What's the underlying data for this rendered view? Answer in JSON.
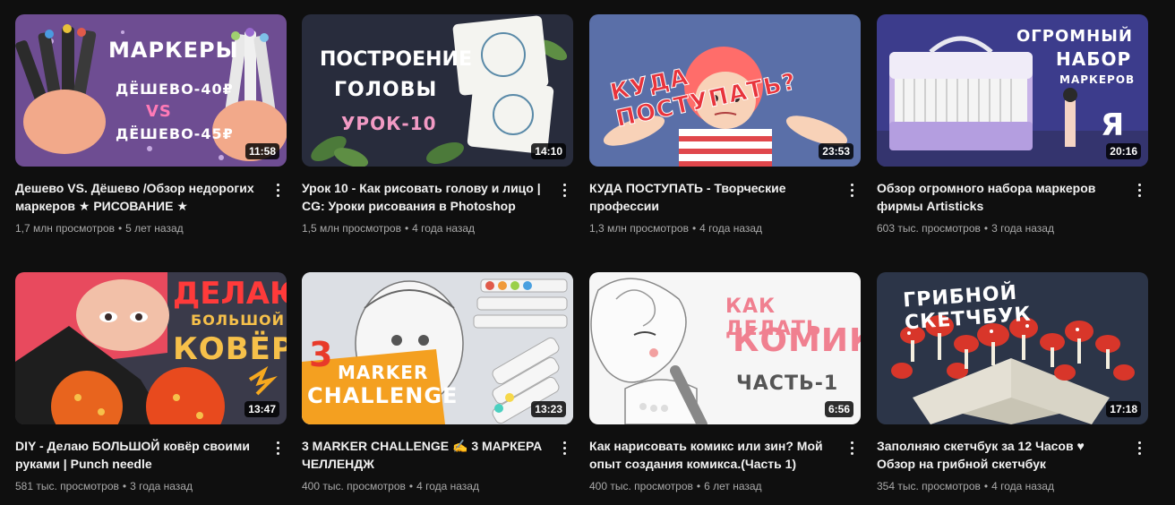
{
  "videos": [
    {
      "title": "Дешево VS. Дёшево /Обзор недорогих маркеров ★ РИСОВАНИЕ ★",
      "views": "1,7 млн просмотров",
      "age": "5 лет назад",
      "duration": "11:58",
      "thumb_text": [
        "МАРКЕРЫ",
        "ДЁШЕВО-40₽",
        "VS",
        "ДЁШЕВО-45₽"
      ]
    },
    {
      "title": "Урок 10 - Как рисовать голову и лицо | CG: Уроки рисования в Photoshop",
      "views": "1,5 млн просмотров",
      "age": "4 года назад",
      "duration": "14:10",
      "thumb_text": [
        "ПОСТРОЕНИЕ",
        "ГОЛОВЫ",
        "УРОК-10"
      ]
    },
    {
      "title": "КУДА ПОСТУПАТЬ - Творческие профессии",
      "views": "1,3 млн просмотров",
      "age": "4 года назад",
      "duration": "23:53",
      "thumb_text": [
        "КУДА ПОСТУПАТЬ?"
      ]
    },
    {
      "title": "Обзор огромного набора маркеров фирмы Artisticks",
      "views": "603 тыс. просмотров",
      "age": "3 года назад",
      "duration": "20:16",
      "thumb_text": [
        "ОГРОМНЫЙ",
        "НАБОР",
        "МАРКЕРОВ",
        "Я"
      ]
    },
    {
      "title": "DIY - Делаю БОЛЬШОЙ ковёр своими руками | Punch needle",
      "views": "581 тыс. просмотров",
      "age": "3 года назад",
      "duration": "13:47",
      "thumb_text": [
        "ДЕЛАЮ",
        "БОЛЬШОЙ",
        "КОВЁР"
      ]
    },
    {
      "title": "3 MARKER CHALLENGE ✍️ 3 МАРКЕРА ЧЕЛЛЕНДЖ",
      "views": "400 тыс. просмотров",
      "age": "4 года назад",
      "duration": "13:23",
      "thumb_text": [
        "3",
        "MARKER",
        "CHALLENGE"
      ]
    },
    {
      "title": "Как нарисовать комикс или зин? Мой опыт создания комикса.(Часть 1)",
      "views": "400 тыс. просмотров",
      "age": "6 лет назад",
      "duration": "6:56",
      "thumb_text": [
        "КАК ДЕЛАТЬ",
        "КОМИКС",
        "ЧАСТЬ-1"
      ]
    },
    {
      "title": "Заполняю скетчбук за 12 Часов ♥ Обзор на грибной скетчбук",
      "views": "354 тыс. просмотров",
      "age": "4 года назад",
      "duration": "17:18",
      "thumb_text": [
        "ГРИБНОЙ СКЕТЧБУК"
      ]
    }
  ],
  "meta_separator": "•",
  "icons": {
    "more": "more-vert-icon"
  }
}
